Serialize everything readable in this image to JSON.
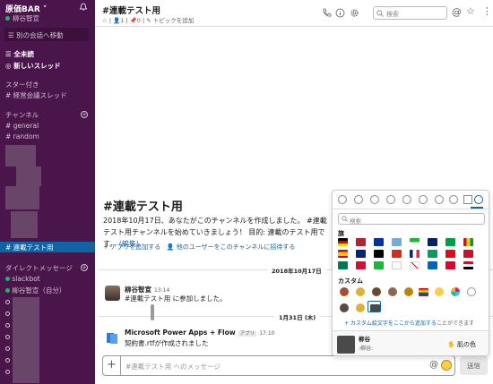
{
  "workspace": {
    "name": "原価BAR",
    "user": "柳谷智宣"
  },
  "sidebar": {
    "jump_label": "別の会話へ移動",
    "all_unread": "全未読",
    "new_threads": "新しいスレッド",
    "starred_header": "スター付き",
    "starred_item": "# 経営会議スレッド",
    "channels_header": "チャンネル",
    "channels": [
      "# general",
      "# random"
    ],
    "active_channel": "# 連載テスト用",
    "dm_header": "ダイレクトメッセージ",
    "dms": [
      "slackbot",
      "柳谷智宣（自分）"
    ]
  },
  "header": {
    "channel": "#連載テスト用",
    "meta": "☆ | 👤1 | 📌0 | ✎ トピックを追加",
    "search_placeholder": "検索"
  },
  "intro": {
    "title": "#連載テスト用",
    "text": "2018年10月17日、あなたがこのチャンネルを作成しました。 #連載テスト用チャンネルを始めていきましょう！ 目的: 連載のテスト用です。",
    "edit_link": "(編集)",
    "add_app": "+ アプリを追加する",
    "invite": "👤 他のユーザーをこのチャンネルに招待する"
  },
  "messages": {
    "date1": "2018年10月17日",
    "msg1_author": "柳谷智宣",
    "msg1_time": "13:14",
    "msg1_text": "#連載テスト用 に参加しました。",
    "date2": "1月31日 (木)",
    "msg2_author": "Microsoft Power Apps + Flow",
    "msg2_badge": "アプリ",
    "msg2_time": "17:10",
    "msg2_text": "契約書.rtfが作成されました"
  },
  "composer": {
    "placeholder": "#連載テスト用 へのメッセージ",
    "send": "送信"
  },
  "picker": {
    "search_placeholder": "検索",
    "flags_label": "旗",
    "custom_label": "カスタム",
    "add_link": "+ カスタム絵文字をここから追加する",
    "add_rest": "ことができます",
    "preview_name": "柳谷",
    "preview_code": ":柳谷:",
    "skin_tone": "✋ 肌の色"
  }
}
